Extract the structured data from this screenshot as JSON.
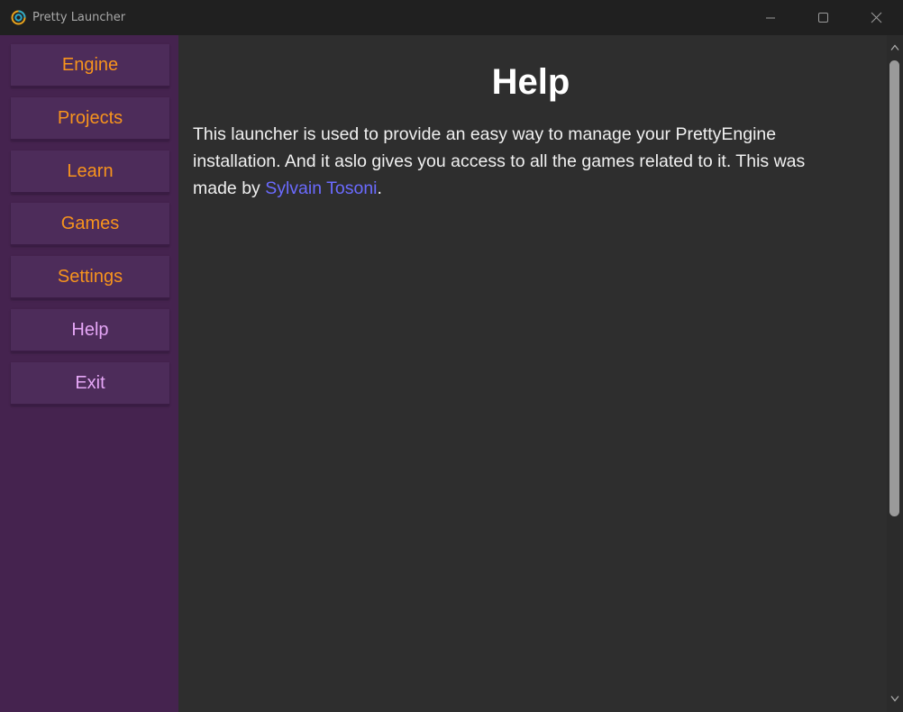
{
  "window": {
    "title": "Pretty Launcher",
    "controls": [
      "minimize-icon",
      "maximize-icon",
      "close-icon"
    ]
  },
  "sidebar": {
    "items": [
      {
        "label": "Engine"
      },
      {
        "label": "Projects"
      },
      {
        "label": "Learn"
      },
      {
        "label": "Games"
      },
      {
        "label": "Settings"
      },
      {
        "label": "Help"
      },
      {
        "label": "Exit"
      }
    ]
  },
  "help": {
    "title": "Help",
    "body_before_link": "This launcher is used to provide an easy way to manage your PrettyEngine installation. And it aslo gives you access to all the games related to it. This was made by ",
    "link_text": "Sylvain Tosoni",
    "body_after_link": "."
  },
  "colors": {
    "sidebar_bg": "#45234f",
    "button_bg": "#4d2c5a",
    "accent_orange": "#f7941d",
    "accent_pink": "#e6a7f7",
    "content_bg": "#2e2e2e",
    "link": "#6b6bff"
  }
}
